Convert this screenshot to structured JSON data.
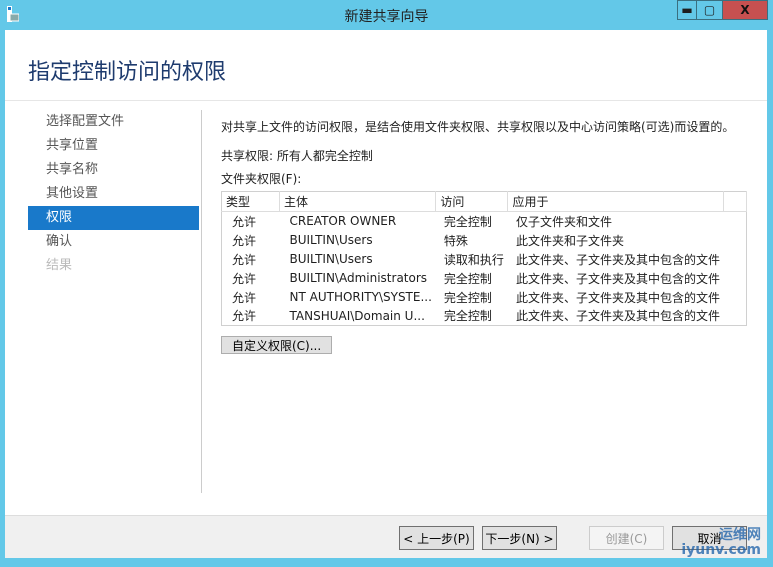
{
  "window": {
    "title": "新建共享向导",
    "minimize": "▬",
    "maximize": "▢",
    "close": "X"
  },
  "header": {
    "title": "指定控制访问的权限"
  },
  "nav": {
    "items": [
      {
        "label": "选择配置文件"
      },
      {
        "label": "共享位置"
      },
      {
        "label": "共享名称"
      },
      {
        "label": "其他设置"
      },
      {
        "label": "权限"
      },
      {
        "label": "确认"
      },
      {
        "label": "结果"
      }
    ]
  },
  "main": {
    "description": "对共享上文件的访问权限，是结合使用文件夹权限、共享权限以及中心访问策略(可选)而设置的。",
    "share_permissions": "共享权限: 所有人都完全控制",
    "folder_permissions_label": "文件夹权限(F):",
    "columns": [
      "类型",
      "主体",
      "访问",
      "应用于"
    ],
    "rows": [
      [
        "允许",
        "CREATOR OWNER",
        "完全控制",
        "仅子文件夹和文件"
      ],
      [
        "允许",
        "BUILTIN\\Users",
        "特殊",
        "此文件夹和子文件夹"
      ],
      [
        "允许",
        "BUILTIN\\Users",
        "读取和执行",
        "此文件夹、子文件夹及其中包含的文件"
      ],
      [
        "允许",
        "BUILTIN\\Administrators",
        "完全控制",
        "此文件夹、子文件夹及其中包含的文件"
      ],
      [
        "允许",
        "NT AUTHORITY\\SYSTE...",
        "完全控制",
        "此文件夹、子文件夹及其中包含的文件"
      ],
      [
        "允许",
        "TANSHUAI\\Domain U...",
        "完全控制",
        "此文件夹、子文件夹及其中包含的文件"
      ]
    ],
    "custom_button": "自定义权限(C)..."
  },
  "footer": {
    "prev": "< 上一步(P)",
    "next": "下一步(N) >",
    "create": "创建(C)",
    "cancel": "取消"
  },
  "watermark": {
    "line1": "运维网",
    "line2": "iyunv.com"
  }
}
